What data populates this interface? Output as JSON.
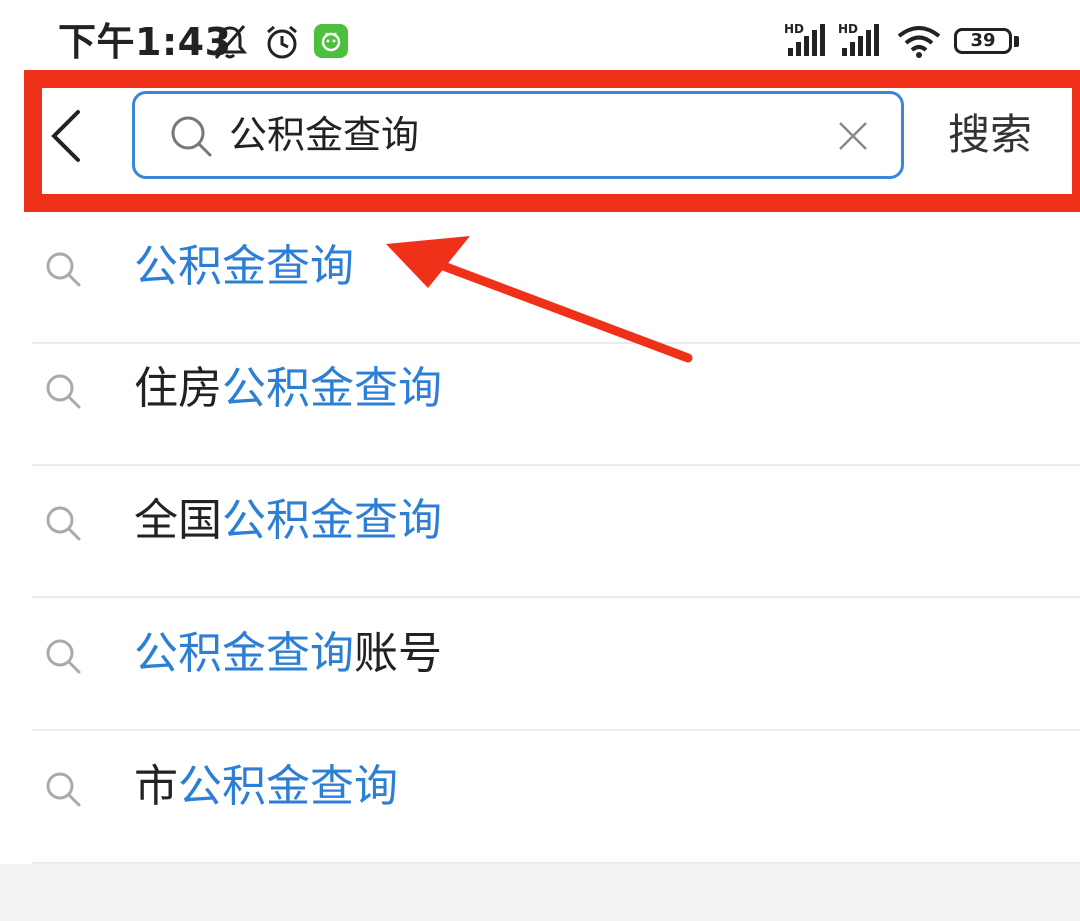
{
  "status_bar": {
    "time": "下午1:43",
    "signal_1_label": "HD",
    "signal_2_label": "HD",
    "battery": "39",
    "icons": [
      "bell-muted-icon",
      "alarm-clock-icon",
      "app-notification-icon",
      "signal-icon",
      "signal-icon",
      "wifi-icon",
      "battery-icon"
    ]
  },
  "search": {
    "query": "公积金查询",
    "search_button": "搜索",
    "back_icon": "chevron-left-icon",
    "clear_icon": "close-icon",
    "search_icon": "search-icon"
  },
  "suggestions": [
    {
      "prefix": "",
      "highlight": "公积金查询",
      "suffix": ""
    },
    {
      "prefix": "住房",
      "highlight": "公积金查询",
      "suffix": ""
    },
    {
      "prefix": "全国",
      "highlight": "公积金查询",
      "suffix": ""
    },
    {
      "prefix": "",
      "highlight": "公积金查询",
      "suffix": "账号"
    },
    {
      "prefix": "市",
      "highlight": "公积金查询",
      "suffix": ""
    }
  ],
  "colors": {
    "highlight": "#2d7fd6",
    "annotation_red": "#f0311a",
    "search_border": "#3b86d9",
    "app_badge": "#4cbf3c"
  }
}
